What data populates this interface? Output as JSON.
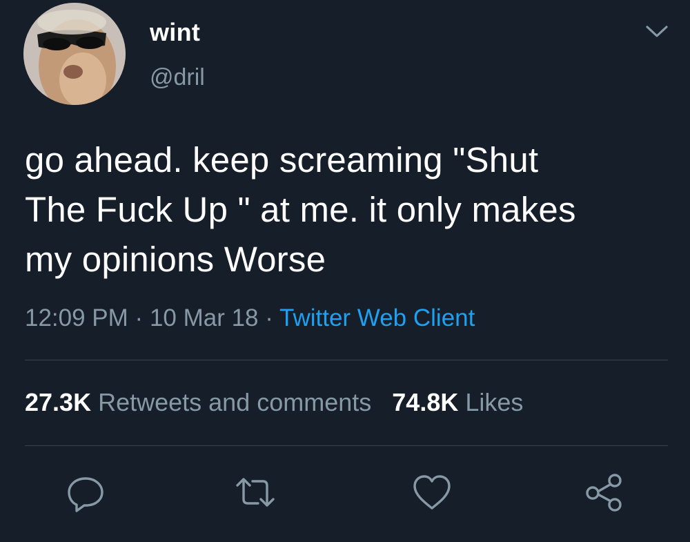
{
  "author": {
    "display_name": "wint",
    "handle": "@dril"
  },
  "tweet": {
    "text_lines": [
      "go ahead. keep screaming \"Shut",
      "The Fuck Up \" at me. it only makes",
      "my opinions Worse"
    ],
    "time": "12:09 PM",
    "separator": "·",
    "date": "10 Mar 18",
    "source": "Twitter Web Client"
  },
  "stats": {
    "retweets_count": "27.3K",
    "retweets_label": "Retweets and comments",
    "likes_count": "74.8K",
    "likes_label": "Likes"
  },
  "icons": {
    "menu": "chevron-down-icon",
    "reply": "reply-icon",
    "retweet": "retweet-icon",
    "like": "heart-icon",
    "share": "share-icon"
  },
  "colors": {
    "background": "#151e29",
    "secondary_text": "#8899a6",
    "link": "#1da1f2",
    "divider": "#38444d"
  }
}
